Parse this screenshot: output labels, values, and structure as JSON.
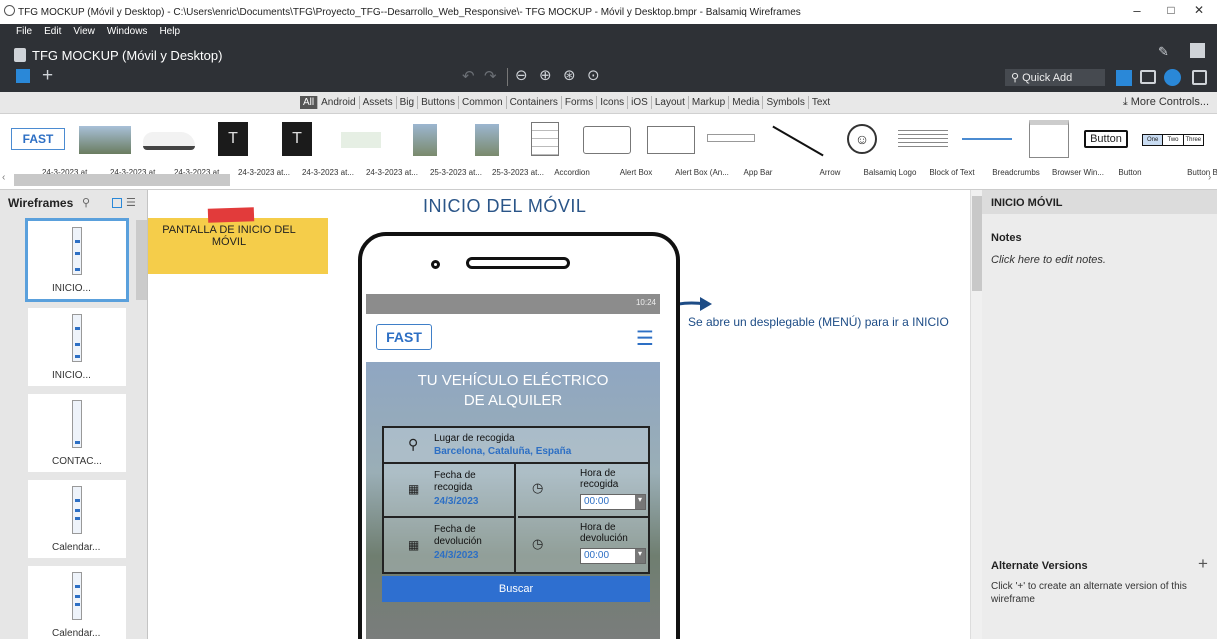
{
  "window": {
    "title": "TFG MOCKUP (Móvil y Desktop) - C:\\Users\\enric\\Documents\\TFG\\Proyecto_TFG--Desarrollo_Web_Responsive\\- TFG MOCKUP - Móvil y Desktop.bmpr - Balsamiq Wireframes",
    "minimize": "–",
    "maximize": "□",
    "close": "✕"
  },
  "menu": [
    "File",
    "Edit",
    "View",
    "Windows",
    "Help"
  ],
  "project": {
    "title": "TFG MOCKUP (Móvil y Desktop)",
    "quick_add": "Quick Add"
  },
  "categories": {
    "items": [
      "All",
      "Android",
      "Assets",
      "Big",
      "Buttons",
      "Common",
      "Containers",
      "Forms",
      "Icons",
      "iOS",
      "Layout",
      "Markup",
      "Media",
      "Symbols",
      "Text"
    ],
    "more_controls": "More Controls..."
  },
  "library": [
    "24-3-2023 at...",
    "24-3-2023 at...",
    "24-3-2023 at...",
    "24-3-2023 at...",
    "24-3-2023 at...",
    "24-3-2023 at...",
    "25-3-2023 at...",
    "25-3-2023 at...",
    "Accordion",
    "Alert Box",
    "Alert Box (An...",
    "App Bar",
    "Arrow",
    "Balsamiq Logo",
    "Block of Text",
    "Breadcrumbs",
    "Browser Win...",
    "Button",
    "Button Bar"
  ],
  "library_thumb_button": "Button",
  "library_thumb_buttonbar": [
    "One",
    "Two",
    "Three"
  ],
  "wireframes": {
    "header": "Wireframes",
    "items": [
      "INICIO...",
      "INICIO...",
      "CONTAC...",
      "Calendar...",
      "Calendar..."
    ]
  },
  "canvas": {
    "page_title": "INICIO DEL MÓVIL",
    "sticky_note": "PANTALLA DE INICIO DEL MÓVIL",
    "annotation": "Se  abre un desplegable (MENÚ) para ir a INICIO",
    "phone": {
      "status_time": "10:24",
      "logo": "FAST",
      "hero_line1": "TU VEHÍCULO ELÉCTRICO",
      "hero_line2": "DE ALQUILER",
      "pickup_label": "Lugar de recogida",
      "pickup_value": "Barcelona, Cataluña, España",
      "pickup_date_label_1": "Fecha de",
      "pickup_date_label_2": "recogida",
      "pickup_date_value": "24/3/2023",
      "pickup_time_label_1": "Hora de",
      "pickup_time_label_2": "recogida",
      "pickup_time_value": "00:00",
      "return_date_label_1": "Fecha de",
      "return_date_label_2": "devolución",
      "return_date_value": "24/3/2023",
      "return_time_label_1": "Hora de",
      "return_time_label_2": "devolución",
      "return_time_value": "00:00",
      "search_button": "Buscar"
    }
  },
  "right_panel": {
    "title": "INICIO MÓVIL",
    "notes_label": "Notes",
    "notes_placeholder": "Click here to edit notes.",
    "alt_label": "Alternate Versions",
    "alt_hint": "Click '+' to create an alternate version of this wireframe"
  }
}
